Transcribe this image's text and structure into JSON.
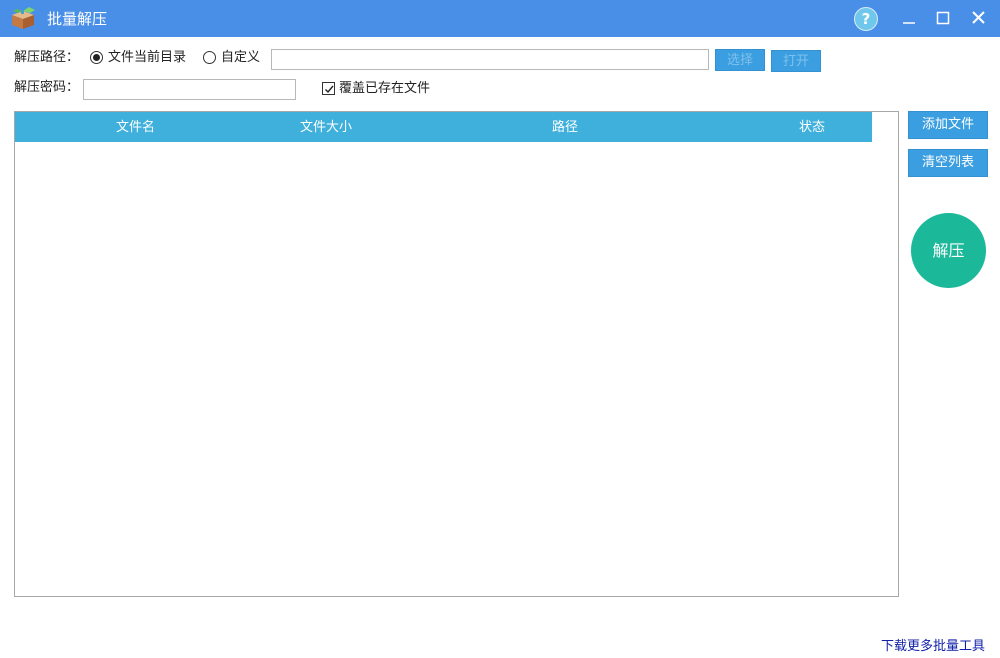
{
  "titlebar": {
    "title": "批量解压",
    "help_label": "?",
    "icons": [
      "box-app-icon",
      "help-icon",
      "minimize-icon",
      "maximize-icon",
      "close-icon"
    ]
  },
  "path_row": {
    "label": "解压路径：",
    "option_current": "文件当前目录",
    "option_custom": "自定义",
    "selected": "文件当前目录",
    "path_value": "",
    "browse_label": "选择",
    "open_label": "打开"
  },
  "password_row": {
    "label": "解压密码：",
    "password_value": "",
    "overwrite_label": "覆盖已存在文件",
    "overwrite_checked": true
  },
  "file_list": {
    "columns": [
      "文件名",
      "文件大小",
      "路径",
      "状态"
    ],
    "rows": []
  },
  "side": {
    "add_label": "添加文件",
    "clear_label": "清空列表",
    "extract_label": "解压"
  },
  "footer": {
    "more_link": "下载更多批量工具"
  },
  "colors": {
    "titlebar": "#4a8fe7",
    "header": "#3fb0dc",
    "button": "#3b9ee0",
    "extract": "#1bb99a",
    "link": "#1020a8"
  }
}
